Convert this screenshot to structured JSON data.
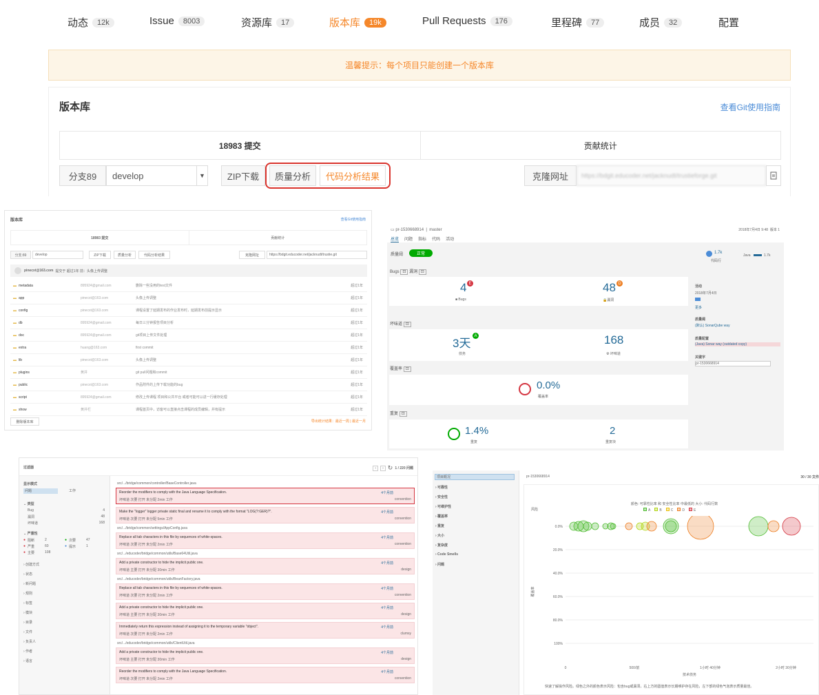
{
  "tabs": [
    {
      "label": "动态",
      "count": "12k"
    },
    {
      "label": "Issue",
      "count": "8003"
    },
    {
      "label": "资源库",
      "count": "17"
    },
    {
      "label": "版本库",
      "count": "19k"
    },
    {
      "label": "Pull Requests",
      "count": "176"
    },
    {
      "label": "里程碑",
      "count": "77"
    },
    {
      "label": "成员",
      "count": "32"
    },
    {
      "label": "配置",
      "count": ""
    }
  ],
  "tip": "温馨提示：每个项目只能创建一个版本库",
  "repo": {
    "title": "版本库",
    "guide_link": "查看Git使用指南",
    "commits": "18983 提交",
    "contrib": "贡献统计",
    "branch_label": "分支89",
    "branch_value": "develop",
    "zip_button": "ZIP下载",
    "quality_button": "质量分析",
    "code_result_button": "代码分析结果",
    "clone_label": "克隆网址",
    "clone_url": "https://bdgit.educoder.net/jacknudt/trustieforge.git"
  },
  "mini_repo": {
    "title": "版本库",
    "guide": "查看Git使用指南",
    "commits": "18983 提交",
    "contrib": "贡献统计",
    "branch": "分支:89",
    "branch_value": "develop",
    "zip": "ZIP下载",
    "quality": "质量分析",
    "code_result": "代码分析结果",
    "clone": "克隆网址",
    "clone_url": "https://bdgit.educoder.net/jacknudt/trustie.git",
    "commit_author": "pinecxt@163.com",
    "commit_msg": "提交于 超过1年 前：头像上传调整",
    "files": [
      {
        "name": "metadata",
        "author": "895924@gmail.com",
        "msg": "删除一些没用的test文件",
        "time": "超过1年"
      },
      {
        "name": "app",
        "author": "pinecxt@163.com",
        "msg": "头像上传调整",
        "time": "超过1年"
      },
      {
        "name": "config",
        "author": "pinecxt@163.com",
        "msg": "课程设置了延期发布的作业发布时，延期发布前提示显示",
        "time": "超过1年"
      },
      {
        "name": "db",
        "author": "895924@gmail.com",
        "msg": "每日三分钟报告项目分析",
        "time": "超过1年"
      },
      {
        "name": "doc",
        "author": "895924@gmail.com",
        "msg": "git项目上传文件处理",
        "time": "超过1年"
      },
      {
        "name": "extra",
        "author": "huang@163.com",
        "msg": "first commit",
        "time": "超过1年"
      },
      {
        "name": "lib",
        "author": "pinecxt@163.com",
        "msg": "头像上传调整",
        "time": "超过1年"
      },
      {
        "name": "plugins",
        "author": "黄井",
        "msg": "git pull问题和commit",
        "time": "超过1年"
      },
      {
        "name": "public",
        "author": "pinecxt@163.com",
        "msg": "作品附件的上传下载功能的bug",
        "time": "超过1年"
      },
      {
        "name": "script",
        "author": "895924@gmail.com",
        "msg": "修改上传课程 项目和公共平台 或者可能可以进一行缓存处理",
        "time": "超过1年"
      },
      {
        "name": "show",
        "author": "黄井栏",
        "msg": "课程首页中，访客可以直接点击课程的成员编辑，并有提示",
        "time": "超过1年"
      }
    ],
    "delete_btn": "删除版本库",
    "footer": "导出统计结果：最近一周 | 最近一月"
  },
  "sonar": {
    "project": "pr-1530668914",
    "branch": "master",
    "date": "2018年7月4日 9:48",
    "version": "版本 1",
    "nav": [
      "总览",
      "问题",
      "指标",
      "代码",
      "活动"
    ],
    "gate": "质量阈",
    "gate_status": "正常",
    "bugs_title": "Bugs",
    "vuln_title": "漏洞",
    "bugs": "4",
    "bugs_grade": "E",
    "bugs_label": "Bugs",
    "vulns": "48",
    "vulns_grade": "D",
    "vulns_label": "漏洞",
    "smell_title": "坏味道",
    "debt": "3天",
    "debt_grade": "A",
    "debt_label": "债务",
    "smells": "168",
    "smells_label": "坏味道",
    "cov_title": "覆盖率",
    "coverage": "0.0%",
    "coverage_label": "覆盖率",
    "dup_title": "重复",
    "dup": "1.4%",
    "dup_label": "重复",
    "dup_blocks": "2",
    "dup_blocks_label": "重复块",
    "loc": "1.7k",
    "loc_label": "代码行",
    "lang": "Java",
    "lang_loc": "1.7k",
    "activity": "活动",
    "activity_date": "2018年7月4日",
    "more": "更多",
    "profile": "质量阈",
    "profile_val": "(默认) SonarQube way",
    "quality_profile": "质量配置",
    "qp_val": "(Java) Sonar way (outdated copy)",
    "key": "关键字",
    "key_val": "pr-1530668914"
  },
  "issues": {
    "filter": "过滤器",
    "display_mode": "显示模式",
    "mode_issue": "问题",
    "mode_effort": "工作",
    "type": "类型",
    "types": [
      {
        "n": "Bug",
        "c": "4"
      },
      {
        "n": "漏洞",
        "c": "48"
      },
      {
        "n": "坏味道",
        "c": "168"
      }
    ],
    "severity": "严重性",
    "severities": [
      {
        "n": "阻断",
        "c": "2"
      },
      {
        "n": "严重",
        "c": "60"
      },
      {
        "n": "主要",
        "c": "108"
      },
      {
        "n": "次要",
        "c": "47"
      },
      {
        "n": "提示",
        "c": "1"
      }
    ],
    "facets": [
      "创建方式",
      "状态",
      "新问题",
      "规则",
      "标签",
      "模块",
      "目录",
      "文件",
      "负责人",
      "作者",
      "语言"
    ],
    "counter": "1 / 220 问题",
    "rows": [
      {
        "file": "src/.../bridge/common/controller/BaseController.java",
        "msg": "Reorder the modifiers to comply with the Java Language Specification.",
        "tag": "convention",
        "meta": "坏味道  次要  打开  未分配  2min 工作"
      },
      {
        "file": "",
        "msg": "Make the \"logger\" logger private static final and rename it to comply with the format \"LOG(?:GER)?\".",
        "tag": "convention",
        "meta": "坏味道  次要  打开  未分配  5min 工作"
      },
      {
        "file": "src/.../bridge/common/settings/AppConfig.java",
        "msg": "Replace all tab characters in this file by sequences of white-spaces.",
        "tag": "convention",
        "meta": "坏味道  次要  打开  未分配  2min 工作"
      },
      {
        "file": "src/.../educoder/bridge/common/utils/Base64Util.java",
        "msg": "Add a private constructor to hide the implicit public one.",
        "tag": "design",
        "meta": "坏味道  主要  打开  未分配  30min 工作"
      },
      {
        "file": "src/.../educoder/bridge/common/utils/BeanFactory.java",
        "msg": "Replace all tab characters in this file by sequences of white-spaces.",
        "tag": "convention",
        "meta": "坏味道  次要  打开  未分配  2min 工作"
      },
      {
        "file": "",
        "msg": "Add a private constructor to hide the implicit public one.",
        "tag": "design",
        "meta": "坏味道  主要  打开  未分配  30min 工作"
      },
      {
        "file": "",
        "msg": "Immediately return this expression instead of assigning it to the temporary variable \"object\".",
        "tag": "clumsy",
        "meta": "坏味道  次要  打开  未分配  2min 工作"
      },
      {
        "file": "src/.../educoder/bridge/common/utils/ClientUtil.java",
        "msg": "Add a private constructor to hide the implicit public one.",
        "tag": "design",
        "meta": "坏味道  主要  打开  未分配  30min 工作"
      },
      {
        "file": "",
        "msg": "Reorder the modifiers to comply with the Java Language Specification.",
        "tag": "convention",
        "meta": "坏味道  次要  打开  未分配  2min 工作"
      }
    ],
    "age": "4个月前"
  },
  "bubble": {
    "side_active": "项目概况",
    "side": [
      "可靠性",
      "安全性",
      "可维护性",
      "覆盖率",
      "重复",
      "大小",
      "复杂度",
      "Code Smells",
      "问题"
    ],
    "project": "pr-1530668914",
    "pager": "30 / 30 文件",
    "risk": "风险",
    "legend_title": "颜色: 可靠性比率 和 安全性比率 中最低的  大小: 代码行数",
    "grades": [
      "A",
      "B",
      "C",
      "D",
      "E"
    ],
    "grade_colors": [
      "#4cba2e",
      "#b0d513",
      "#eabe06",
      "#ed7d20",
      "#d4333f"
    ],
    "yticks": [
      "0.0%",
      "20.0%",
      "40.0%",
      "60.0%",
      "80.0%",
      "100%"
    ],
    "xticks": [
      "0",
      "500/前",
      "1小时 40分钟",
      "2小时 30分钟"
    ],
    "xlabel": "技术债务",
    "ylabel": "覆盖率",
    "note": "快速了解操作风险。绿色之外的颜色表示风险：包含bug或漏洞，右上方的圆值表示长期维护存在风险，左下部的绿色气泡表示质量最佳。"
  }
}
